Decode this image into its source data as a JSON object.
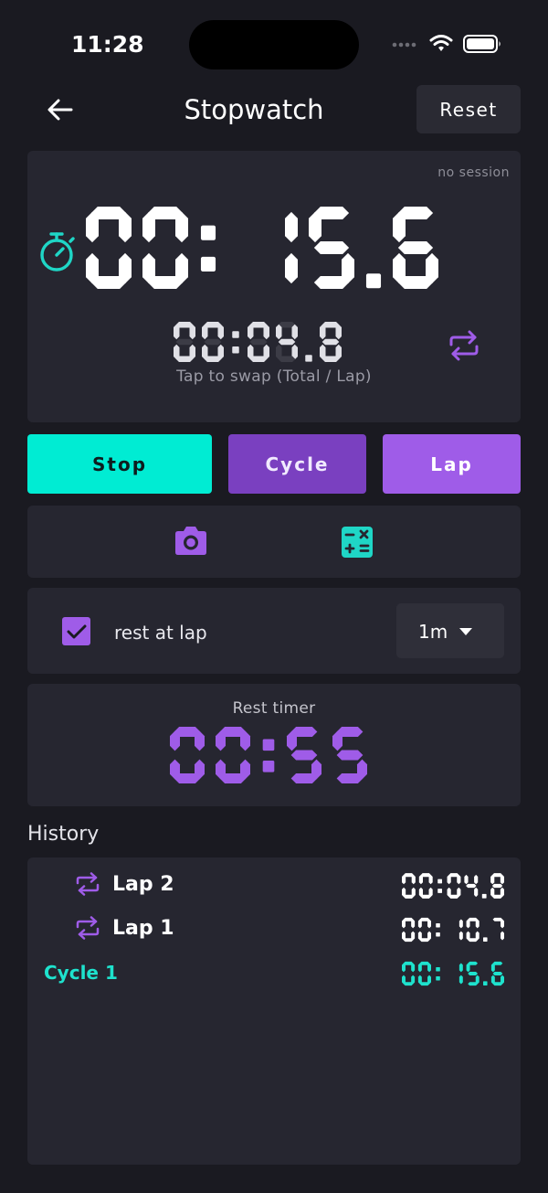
{
  "status": {
    "time": "11:28"
  },
  "header": {
    "title": "Stopwatch",
    "reset_label": "Reset"
  },
  "timer": {
    "session_label": "no session",
    "main_time": "00: 15.6",
    "lap_time": "00:04.8",
    "swap_hint": "Tap to swap (Total / Lap)"
  },
  "actions": {
    "stop_label": "Stop",
    "cycle_label": "Cycle",
    "lap_label": "Lap"
  },
  "tools": {
    "camera_icon": "camera-icon",
    "calculator_icon": "calculator-icon"
  },
  "rest": {
    "checked": true,
    "label": "rest at lap",
    "duration": "1m"
  },
  "rest_timer": {
    "label": "Rest timer",
    "value": "00:55"
  },
  "history": {
    "heading": "History",
    "entries": [
      {
        "type": "lap",
        "label": "Lap 2",
        "time": "00:04.8"
      },
      {
        "type": "lap",
        "label": "Lap 1",
        "time": "00: 10.7"
      },
      {
        "type": "cycle",
        "label": "Cycle 1",
        "time": "00: 15.6"
      }
    ]
  },
  "colors": {
    "background": "#1a1a21",
    "card": "#262630",
    "teal": "#00ecd3",
    "purple": "#9f5ce8",
    "purple_dark": "#7a40c0"
  }
}
